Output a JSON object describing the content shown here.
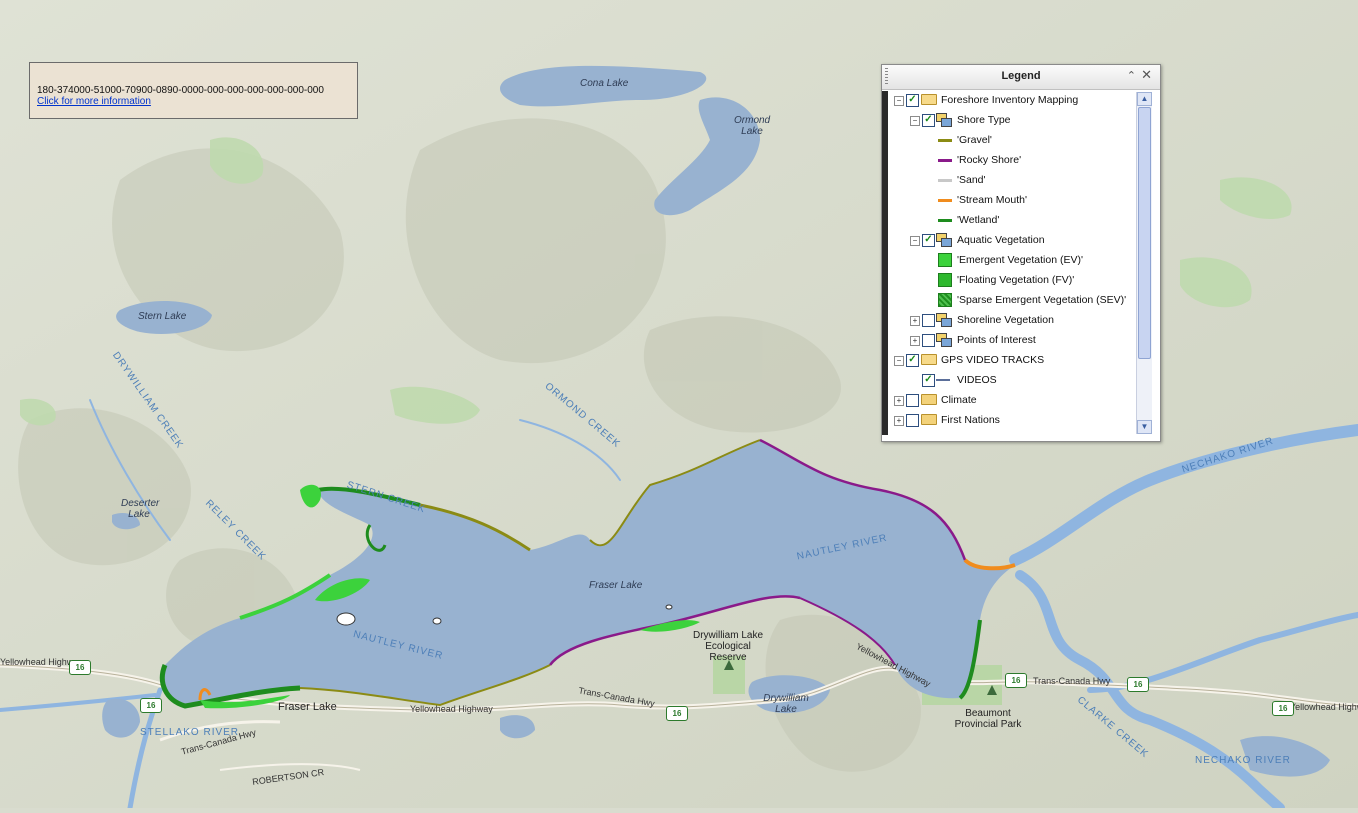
{
  "info_box": {
    "id_text": "180-374000-51000-70900-0890-0000-000-000-000-000-000-000",
    "link_text": "Click for more information"
  },
  "legend": {
    "title": "Legend",
    "collapse_icon": "double-chevron-up-icon",
    "close_icon": "close-icon",
    "items": [
      {
        "label": "Foreshore Inventory Mapping",
        "checked": true,
        "expanded": true,
        "icon": "folder-open-icon"
      },
      {
        "label": "Shore Type",
        "checked": true,
        "expanded": true,
        "icon": "layer-group-icon"
      },
      {
        "label": "'Gravel'",
        "color": "#8b8b14"
      },
      {
        "label": "'Rocky Shore'",
        "color": "#8a1a8a"
      },
      {
        "label": "'Sand'",
        "color": "#c8c8c8"
      },
      {
        "label": "'Stream Mouth'",
        "color": "#f08c1e"
      },
      {
        "label": "'Wetland'",
        "color": "#1e8c1e"
      },
      {
        "label": "Aquatic Vegetation",
        "checked": true,
        "expanded": true,
        "icon": "layer-group-icon"
      },
      {
        "label": "'Emergent Vegetation (EV)'",
        "color": "#3cd23c"
      },
      {
        "label": "'Floating Vegetation (FV)'",
        "color": "#2eb82e"
      },
      {
        "label": "'Sparse Emergent Vegetation (SEV)'",
        "color": "#1f8f1f"
      },
      {
        "label": "Shoreline Vegetation",
        "checked": false,
        "expanded": false,
        "icon": "layer-group-icon"
      },
      {
        "label": "Points of Interest",
        "checked": false,
        "expanded": false,
        "icon": "layer-group-icon"
      },
      {
        "label": "GPS VIDEO TRACKS",
        "checked": true,
        "expanded": true,
        "icon": "folder-open-icon"
      },
      {
        "label": "VIDEOS",
        "checked": true
      },
      {
        "label": "Climate",
        "checked": false,
        "expanded": false,
        "icon": "folder-icon"
      },
      {
        "label": "First Nations",
        "checked": false,
        "expanded": false,
        "icon": "folder-icon"
      }
    ]
  },
  "map": {
    "colors": {
      "land": "#d7dbcb",
      "water": "#98b2d0",
      "forest": "#bfd9ae",
      "river": "#8fb5e0"
    },
    "lakes": [
      "Fraser Lake",
      "Cona Lake",
      "Ormond Lake",
      "Stern Lake",
      "Deserter Lake",
      "Drywilliam Lake"
    ],
    "rivers": [
      "STERN CREEK",
      "NAUTLEY RIVER",
      "NAUTLEY RIVER",
      "STELLAKO RIVER",
      "NECHAKO RIVER",
      "NECHAKO RIVER",
      "ORMOND CREEK",
      "DRYWILLIAM CREEK",
      "CLARKE CREEK",
      "RELEY CREEK"
    ],
    "roads": [
      "Yellowhead Highway",
      "Yellowhead Highway",
      "Yellowhead Highway",
      "Yellowhead Highway",
      "Trans-Canada Hwy",
      "Trans-Canada Hwy",
      "Trans-Canada Hwy",
      "ROBERTSON CR"
    ],
    "places": [
      "Fraser Lake"
    ],
    "parks": [
      "Drywilliam Lake Ecological Reserve",
      "Beaumont Provincial Park"
    ],
    "highway_shield": "16"
  }
}
